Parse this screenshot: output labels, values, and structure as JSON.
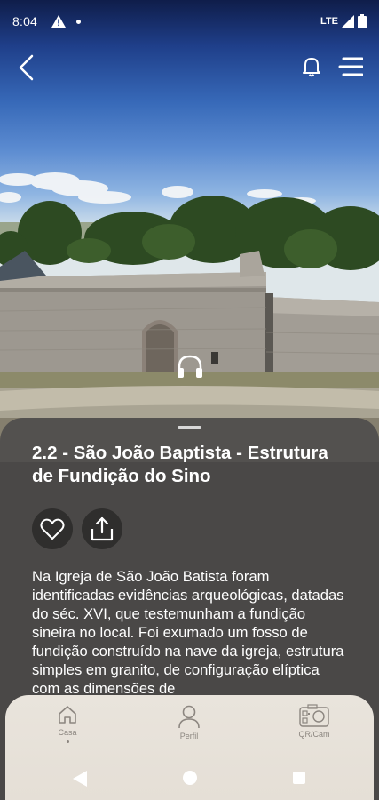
{
  "status_bar": {
    "time": "8:04",
    "network": "LTE"
  },
  "header": {
    "back_icon": "chevron-left-icon",
    "notification_icon": "bell-icon",
    "menu_icon": "hamburger-menu-icon"
  },
  "hero": {
    "audio_icon": "headphones-icon"
  },
  "poi": {
    "title": "2.2 - São João Baptista - Estrutura de Fundição do Sino",
    "favorite_icon": "heart-icon",
    "share_icon": "share-icon",
    "description": "Na Igreja de São João Batista foram identificadas evidências arqueológicas, datadas do séc. XVI, que testemunham a fundição sineira no local. Foi exumado um fosso de fundição construído na nave da igreja, estrutura simples em granito, de configuração elíptica com as dimensões de"
  },
  "bottom_nav": {
    "items": [
      {
        "label": "Casa",
        "icon": "home-icon"
      },
      {
        "label": "Perfil",
        "icon": "user-icon"
      },
      {
        "label": "QR/Cam",
        "icon": "qr-camera-icon"
      }
    ]
  },
  "colors": {
    "sheet_bg": "#504e4c",
    "nav_bg": "#e7e2da",
    "nav_label": "#8c8680",
    "action_button_bg": "#2f2e2d"
  }
}
